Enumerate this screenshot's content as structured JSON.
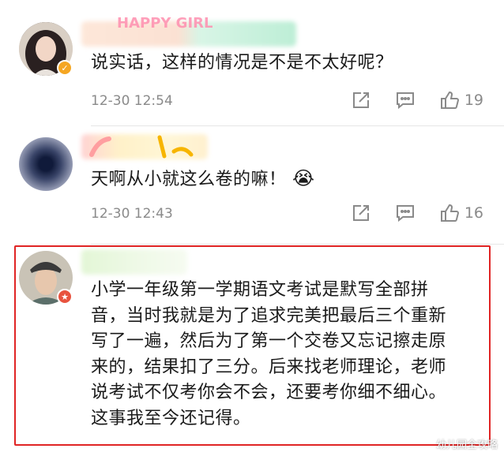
{
  "comments": [
    {
      "text": "说实话，这样的情况是不是不太好呢？",
      "time": "12-30 12:54",
      "likes": "19",
      "name_label": "HAPPY GIRL"
    },
    {
      "text": "天啊从小就这么卷的嘛！",
      "emoji": "😭",
      "time": "12-30 12:43",
      "likes": "16"
    },
    {
      "lines": [
        "小学一年级第一学期语文考试是默写全部拼",
        "音，当时我就是为了追求完美把最后三个重新",
        "写了一遍，然后为了第一个交卷又忘记擦走原",
        "来的，结果扣了三分。后来找老师理论，老师",
        "说考试不仅考你会不会，还要考你细不细心。",
        "这事我至今还记得。"
      ]
    }
  ],
  "icons": {
    "share": "share-icon",
    "comment": "comment-icon",
    "like": "thumbs-up-icon"
  },
  "colors": {
    "highlight_border": "#e02424",
    "meta_text": "#8a8a8a",
    "verified_badge": "#f5a623",
    "vip_badge": "#e8533f"
  },
  "watermark": "幼儿园全攻略"
}
